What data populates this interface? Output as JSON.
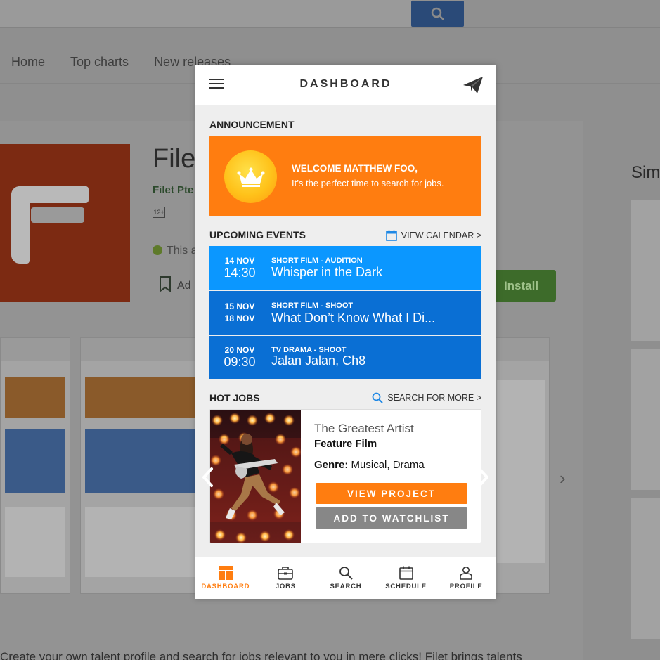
{
  "background": {
    "nav": [
      "Home",
      "Top charts",
      "New releases"
    ],
    "app_title": "Filet",
    "developer": "Filet Pte",
    "content_rating": "12+",
    "notice": "This a",
    "wishlist": "Ad",
    "install": "Install",
    "similar": "Sim",
    "description": "Create your own talent profile and search for jobs relevant to you in mere clicks! Filet brings talents"
  },
  "header": {
    "title": "DASHBOARD",
    "menu_icon": "hamburger-menu-icon",
    "send_icon": "paper-plane-icon"
  },
  "announcement": {
    "label": "ANNOUNCEMENT",
    "heading": "WELCOME MATTHEW FOO,",
    "subtext": "It’s the perfect time to search for jobs.",
    "icon": "crown-icon"
  },
  "upcoming": {
    "label": "UPCOMING EVENTS",
    "link": "VIEW CALENDAR >",
    "events": [
      {
        "date1": "14 NOV",
        "date2": "14:30",
        "type": "SHORT FILM - AUDITION",
        "name": "Whisper in the Dark",
        "color": "#0b97ff"
      },
      {
        "date1": "15 NOV",
        "date2": "18 NOV",
        "type": "SHORT FILM - SHOOT",
        "name": "What Don’t Know What I Di...",
        "color": "#0a6fd4"
      },
      {
        "date1": "20 NOV",
        "date2": "09:30",
        "type": "TV DRAMA - SHOOT",
        "name": "Jalan Jalan, Ch8",
        "color": "#0a6fd4"
      }
    ]
  },
  "hot_jobs": {
    "label": "HOT JOBS",
    "link": "SEARCH FOR MORE >",
    "job": {
      "title": "The Greatest Artist",
      "type": "Feature Film",
      "genre_label": "Genre:",
      "genre": "Musical, Drama"
    },
    "view_button": "VIEW PROJECT",
    "watch_button": "ADD TO WATCHLIST"
  },
  "tabs": [
    {
      "label": "DASHBOARD",
      "icon": "dashboard-icon",
      "active": true
    },
    {
      "label": "JOBS",
      "icon": "briefcase-icon",
      "active": false
    },
    {
      "label": "SEARCH",
      "icon": "search-icon",
      "active": false
    },
    {
      "label": "SCHEDULE",
      "icon": "calendar-icon",
      "active": false
    },
    {
      "label": "PROFILE",
      "icon": "person-icon",
      "active": false
    }
  ],
  "colors": {
    "accent_orange": "#ff7d10",
    "event_blue_light": "#0b97ff",
    "event_blue_dark": "#0a6fd4",
    "button_gray": "#878787"
  }
}
